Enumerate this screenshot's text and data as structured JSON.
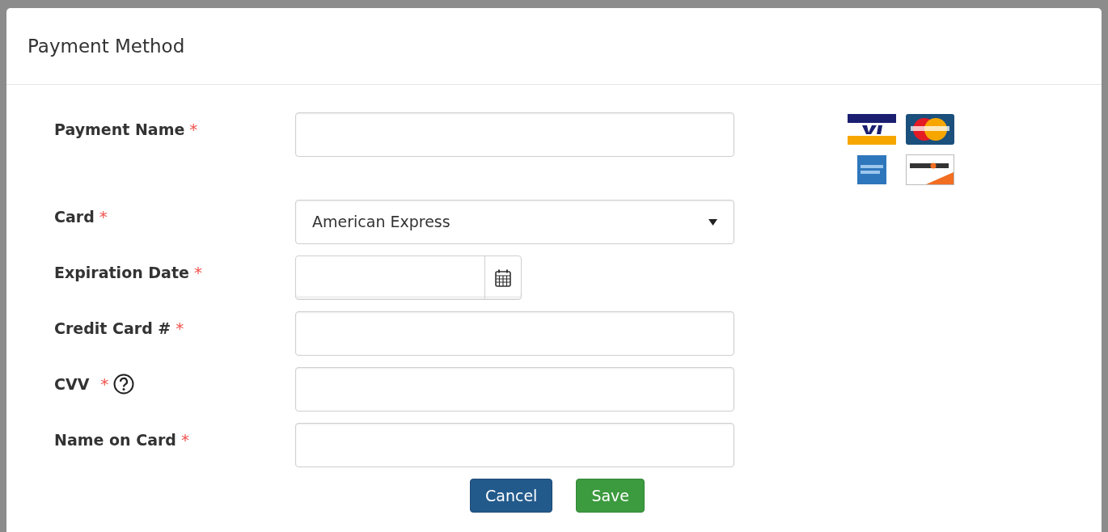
{
  "dialog": {
    "title": "Payment Method"
  },
  "fields": [
    {
      "kind": "text",
      "label": "Payment Name",
      "mark": "*",
      "help": false
    },
    {
      "kind": "select",
      "label": "Card",
      "mark": "*",
      "help": false,
      "value": "American Express"
    },
    {
      "kind": "date",
      "label": "Expiration Date",
      "mark": "*",
      "help": false
    },
    {
      "kind": "text",
      "label": "Credit Card #",
      "mark": "*",
      "help": false
    },
    {
      "kind": "text",
      "label": "CVV",
      "mark": "*",
      "help": true
    },
    {
      "kind": "text",
      "label": "Name on Card",
      "mark": "*",
      "help": false
    }
  ],
  "buttons": [
    {
      "kind": "cancel",
      "label": "Cancel"
    },
    {
      "kind": "save",
      "label": "Save"
    }
  ]
}
